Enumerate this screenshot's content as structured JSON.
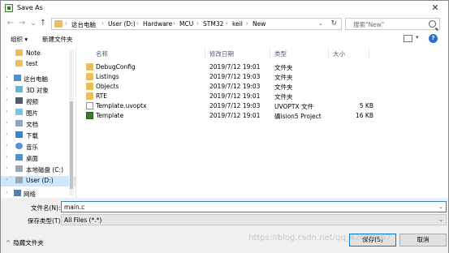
{
  "window": {
    "title": "Save As",
    "close_glyph": "✕"
  },
  "address": {
    "crumbs": [
      "这台电脑",
      "User (D:)",
      "Hardware",
      "MCU",
      "STM32",
      "keil",
      "New"
    ],
    "search_placeholder": "搜索\"New\""
  },
  "toolbar": {
    "organize_label": "组织 ▾",
    "new_folder_label": "新建文件夹",
    "help_glyph": "?"
  },
  "sidebar": {
    "items": [
      {
        "label": "Note",
        "icon": "folder-icon"
      },
      {
        "label": "test",
        "icon": "folder-icon"
      },
      {
        "label": "这台电脑",
        "icon": "computer-icon"
      },
      {
        "label": "3D 对象",
        "icon": "3d-objects-icon"
      },
      {
        "label": "视频",
        "icon": "video-icon"
      },
      {
        "label": "图片",
        "icon": "pictures-icon"
      },
      {
        "label": "文档",
        "icon": "documents-icon"
      },
      {
        "label": "下载",
        "icon": "download-icon"
      },
      {
        "label": "音乐",
        "icon": "music-icon"
      },
      {
        "label": "桌面",
        "icon": "desktop-icon"
      },
      {
        "label": "本地磁盘 (C:)",
        "icon": "disk-icon"
      },
      {
        "label": "User (D:)",
        "icon": "disk-icon"
      },
      {
        "label": "网络",
        "icon": "network-icon"
      }
    ]
  },
  "file_list": {
    "columns": [
      "名称",
      "修改日期",
      "类型",
      "大小"
    ],
    "rows": [
      {
        "name": "DebugConfig",
        "date": "2019/7/12 19:01",
        "type": "文件夹",
        "size": "",
        "icon": "folder-icon"
      },
      {
        "name": "Listings",
        "date": "2019/7/12 19:03",
        "type": "文件夹",
        "size": "",
        "icon": "folder-icon"
      },
      {
        "name": "Objects",
        "date": "2019/7/12 19:03",
        "type": "文件夹",
        "size": "",
        "icon": "folder-icon"
      },
      {
        "name": "RTE",
        "date": "2019/7/12 19:01",
        "type": "文件夹",
        "size": "",
        "icon": "folder-icon"
      },
      {
        "name": "Template.uvoptx",
        "date": "2019/7/12 19:03",
        "type": "UVOPTX 文件",
        "size": "5 KB",
        "icon": "document-icon"
      },
      {
        "name": "Template",
        "date": "2019/7/12 19:01",
        "type": "礦ision5 Project",
        "size": "16 KB",
        "icon": "keil-project-icon"
      }
    ]
  },
  "save_form": {
    "filename_label": "文件名(N):",
    "filename_value": "main.c",
    "filetype_label": "保存类型(T):",
    "filetype_value": "All Files (*.*)",
    "hide_folders_label": "隐藏文件夹",
    "save_label": "保存(S)",
    "cancel_label": "取消"
  },
  "watermark": "https://blog.csdn.net/qq_42650667"
}
